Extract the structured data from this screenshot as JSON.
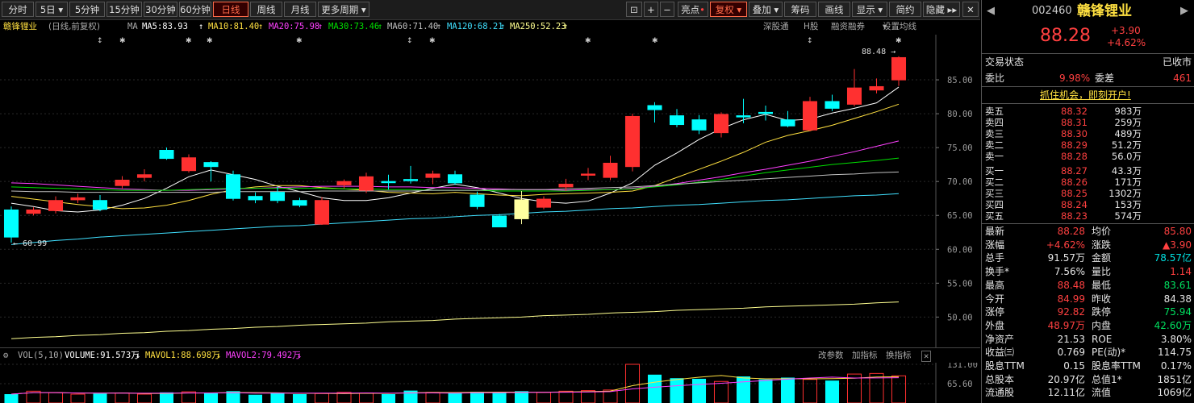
{
  "toolbar": {
    "periods": [
      "分时",
      "5日",
      "5分钟",
      "15分钟",
      "30分钟",
      "60分钟",
      "日线",
      "周线",
      "月线",
      "更多周期"
    ],
    "active_period": "日线",
    "tools": [
      "亮点",
      "复权",
      "叠加",
      "筹码",
      "画线",
      "显示",
      "简约",
      "隐藏"
    ],
    "active_tool": "复权"
  },
  "infobar": {
    "name": "赣锋锂业",
    "mode": "(日线,前复权)",
    "ma_label": "MA",
    "ma5": "MA5:83.93",
    "ma10": "MA10:81.40",
    "ma20": "MA20:75.98",
    "ma30": "MA30:73.46",
    "ma60": "MA60:71.40",
    "ma120": "MA120:68.21",
    "ma250": "MA250:52.23",
    "right_links": [
      "深股通",
      "H股",
      "融资融券",
      "设置均线"
    ],
    "colors": {
      "ma5": "#ffffff",
      "ma10": "#ffe040",
      "ma20": "#ff40ff",
      "ma30": "#00e000",
      "ma60": "#c0c0c0",
      "ma120": "#40e0ff",
      "ma250": "#ffff90"
    }
  },
  "chart_data": [
    {
      "type": "candlestick",
      "title": "赣锋锂业 日线 前复权",
      "price_axis": {
        "ylim": [
          46,
          90
        ],
        "ticks": [
          85.0,
          80.0,
          75.0,
          70.0,
          65.0,
          60.0,
          55.0,
          50.0
        ]
      },
      "candles": [
        {
          "o": 65.8,
          "c": 61.8,
          "h": 66.3,
          "l": 60.99,
          "up": false
        },
        {
          "o": 65.3,
          "c": 65.8,
          "h": 66.2,
          "l": 65.0,
          "up": true
        },
        {
          "o": 65.7,
          "c": 67.2,
          "h": 67.8,
          "l": 65.3,
          "up": true
        },
        {
          "o": 67.3,
          "c": 67.6,
          "h": 68.2,
          "l": 66.8,
          "up": true
        },
        {
          "o": 67.2,
          "c": 65.9,
          "h": 68.0,
          "l": 65.6,
          "up": false
        },
        {
          "o": 69.4,
          "c": 70.2,
          "h": 70.8,
          "l": 69.0,
          "up": true
        },
        {
          "o": 70.6,
          "c": 71.0,
          "h": 71.8,
          "l": 70.0,
          "up": true
        },
        {
          "o": 74.6,
          "c": 73.4,
          "h": 75.0,
          "l": 73.2,
          "up": false
        },
        {
          "o": 71.6,
          "c": 73.5,
          "h": 74.0,
          "l": 71.3,
          "up": true
        },
        {
          "o": 72.8,
          "c": 72.2,
          "h": 73.0,
          "l": 70.0,
          "up": false
        },
        {
          "o": 71.0,
          "c": 67.5,
          "h": 71.6,
          "l": 67.2,
          "up": false
        },
        {
          "o": 67.8,
          "c": 67.3,
          "h": 68.4,
          "l": 66.8,
          "up": false
        },
        {
          "o": 68.4,
          "c": 67.2,
          "h": 69.2,
          "l": 66.8,
          "up": false
        },
        {
          "o": 67.2,
          "c": 66.5,
          "h": 67.6,
          "l": 66.2,
          "up": false
        },
        {
          "o": 67.2,
          "c": 63.7,
          "h": 67.7,
          "l": 63.6,
          "up": true
        },
        {
          "o": 69.5,
          "c": 70.0,
          "h": 70.3,
          "l": 69.0,
          "up": true
        },
        {
          "o": 68.7,
          "c": 70.7,
          "h": 71.3,
          "l": 68.3,
          "up": true
        },
        {
          "o": 70.0,
          "c": 70.0,
          "h": 71.0,
          "l": 68.8,
          "up": false
        },
        {
          "o": 70.3,
          "c": 70.3,
          "h": 72.3,
          "l": 69.7,
          "up": false
        },
        {
          "o": 70.6,
          "c": 71.1,
          "h": 71.6,
          "l": 69.6,
          "up": true
        },
        {
          "o": 71.0,
          "c": 69.8,
          "h": 71.6,
          "l": 69.5,
          "up": false
        },
        {
          "o": 68.0,
          "c": 66.3,
          "h": 68.5,
          "l": 65.9,
          "up": false
        },
        {
          "o": 64.9,
          "c": 63.3,
          "h": 65.2,
          "l": 63.3,
          "up": false
        },
        {
          "o": 67.3,
          "c": 64.5,
          "h": 68.6,
          "l": 63.7,
          "neutral": true
        },
        {
          "o": 66.2,
          "c": 67.4,
          "h": 67.8,
          "l": 65.9,
          "up": true
        },
        {
          "o": 69.2,
          "c": 69.6,
          "h": 70.4,
          "l": 68.6,
          "up": true
        },
        {
          "o": 71.0,
          "c": 71.1,
          "h": 72.0,
          "l": 70.2,
          "up": true
        },
        {
          "o": 70.6,
          "c": 72.7,
          "h": 73.8,
          "l": 70.2,
          "up": true
        },
        {
          "o": 72.2,
          "c": 79.6,
          "h": 80.0,
          "l": 71.5,
          "up": true
        },
        {
          "o": 81.2,
          "c": 80.6,
          "h": 81.7,
          "l": 78.7,
          "up": false
        },
        {
          "o": 79.7,
          "c": 78.4,
          "h": 80.7,
          "l": 78.0,
          "up": false
        },
        {
          "o": 79.1,
          "c": 77.6,
          "h": 79.8,
          "l": 77.0,
          "up": false
        },
        {
          "o": 77.2,
          "c": 79.9,
          "h": 80.2,
          "l": 76.5,
          "up": true
        },
        {
          "o": 79.7,
          "c": 79.7,
          "h": 82.2,
          "l": 78.6,
          "up": false
        },
        {
          "o": 80.2,
          "c": 80.2,
          "h": 81.2,
          "l": 79.0,
          "up": false
        },
        {
          "o": 78.2,
          "c": 79.1,
          "h": 80.4,
          "l": 78.0,
          "up": false
        },
        {
          "o": 77.6,
          "c": 81.8,
          "h": 82.5,
          "l": 77.4,
          "up": true
        },
        {
          "o": 81.8,
          "c": 80.8,
          "h": 82.8,
          "l": 80.4,
          "up": false
        },
        {
          "o": 81.4,
          "c": 83.8,
          "h": 86.6,
          "l": 81.1,
          "up": true
        },
        {
          "o": 83.5,
          "c": 84.0,
          "h": 85.2,
          "l": 83.0,
          "up": true
        },
        {
          "o": 84.99,
          "c": 88.28,
          "h": 88.48,
          "l": 84.1,
          "up": true
        }
      ],
      "annotations": {
        "high": "88.48",
        "low": "60.99"
      },
      "ma_lines": {
        "ma5": [
          66.8,
          66.3,
          65.7,
          65.5,
          65.8,
          66.5,
          67.5,
          69.0,
          70.7,
          71.7,
          71.0,
          70.3,
          69.3,
          68.5,
          67.6,
          67.2,
          67.2,
          67.6,
          68.3,
          69.0,
          69.6,
          69.1,
          68.3,
          67.5,
          67.0,
          66.8,
          67.1,
          68.3,
          69.8,
          72.4,
          74.2,
          76.2,
          77.8,
          79.1,
          79.9,
          79.0,
          79.2,
          80.1,
          80.8,
          81.6,
          83.93
        ],
        "ma10": [
          67.8,
          67.4,
          67.0,
          66.6,
          66.3,
          66.0,
          66.1,
          66.5,
          67.2,
          68.1,
          68.8,
          69.2,
          69.4,
          69.4,
          69.1,
          68.9,
          68.7,
          68.4,
          68.3,
          68.2,
          68.4,
          68.2,
          68.0,
          67.9,
          68.1,
          68.2,
          68.3,
          68.4,
          68.6,
          69.4,
          70.6,
          71.8,
          73.0,
          74.3,
          75.8,
          76.8,
          77.5,
          78.3,
          79.3,
          80.3,
          81.4
        ],
        "ma20": [
          69.8,
          69.7,
          69.5,
          69.3,
          69.1,
          68.9,
          68.8,
          68.7,
          68.7,
          68.8,
          68.9,
          69.0,
          69.1,
          69.2,
          69.3,
          69.3,
          69.3,
          69.2,
          69.2,
          69.1,
          69.1,
          69.0,
          68.9,
          68.8,
          68.8,
          68.7,
          68.8,
          68.8,
          69.0,
          69.3,
          69.7,
          70.2,
          70.7,
          71.3,
          71.8,
          72.4,
          73.0,
          73.7,
          74.4,
          75.2,
          75.98
        ],
        "ma30": [
          69.2,
          69.1,
          69.0,
          68.9,
          68.8,
          68.7,
          68.7,
          68.7,
          68.8,
          68.9,
          69.0,
          69.0,
          69.0,
          69.0,
          69.0,
          68.9,
          68.9,
          68.8,
          68.8,
          68.7,
          68.7,
          68.7,
          68.6,
          68.6,
          68.6,
          68.6,
          68.7,
          68.8,
          68.9,
          69.2,
          69.5,
          69.9,
          70.3,
          70.8,
          71.3,
          71.7,
          72.1,
          72.5,
          72.8,
          73.1,
          73.46
        ],
        "ma60": [
          68.6,
          68.5,
          68.5,
          68.4,
          68.4,
          68.4,
          68.4,
          68.4,
          68.4,
          68.4,
          68.5,
          68.5,
          68.5,
          68.5,
          68.6,
          68.6,
          68.6,
          68.6,
          68.6,
          68.7,
          68.7,
          68.7,
          68.8,
          68.8,
          68.8,
          68.9,
          69.0,
          69.1,
          69.2,
          69.4,
          69.6,
          69.8,
          70.0,
          70.2,
          70.4,
          70.6,
          70.8,
          71.0,
          71.1,
          71.3,
          71.4
        ],
        "ma120": [
          60.7,
          61.0,
          61.3,
          61.5,
          61.8,
          62.0,
          62.2,
          62.4,
          62.6,
          62.8,
          63.0,
          63.2,
          63.4,
          63.5,
          63.7,
          63.9,
          64.1,
          64.3,
          64.5,
          64.6,
          64.8,
          65.0,
          65.1,
          65.3,
          65.5,
          65.6,
          65.8,
          66.0,
          66.1,
          66.3,
          66.5,
          66.6,
          66.8,
          67.0,
          67.2,
          67.3,
          67.5,
          67.7,
          67.9,
          68.0,
          68.21
        ],
        "ma250": [
          46.8,
          47.0,
          47.1,
          47.3,
          47.4,
          47.6,
          47.7,
          47.9,
          48.0,
          48.2,
          48.3,
          48.5,
          48.6,
          48.8,
          48.9,
          49.0,
          49.1,
          49.3,
          49.4,
          49.5,
          49.7,
          49.8,
          49.9,
          50.0,
          50.2,
          50.3,
          50.4,
          50.6,
          50.7,
          50.8,
          51.0,
          51.1,
          51.2,
          51.3,
          51.5,
          51.6,
          51.7,
          51.8,
          51.9,
          52.1,
          52.23
        ]
      }
    },
    {
      "type": "bar",
      "title": "VOL(5,10)",
      "volume_axis": {
        "ticks": [
          "131.00",
          "65.60"
        ]
      },
      "vol_label": "VOLUME:91.573万",
      "mavol1_label": "MAVOL1:88.698万",
      "mavol2_label": "MAVOL2:79.492万",
      "values": [
        30,
        40,
        35,
        30,
        32,
        34,
        30,
        36,
        38,
        33,
        40,
        28,
        33,
        30,
        32,
        36,
        34,
        30,
        42,
        36,
        35,
        38,
        34,
        40,
        36,
        40,
        42,
        44,
        131,
        96,
        84,
        82,
        73,
        90,
        80,
        86,
        80,
        76,
        98,
        100,
        92
      ]
    }
  ],
  "volbar": {
    "title": "VOL(5,10)",
    "volume": "VOLUME:91.573万",
    "mavol1": "MAVOL1:88.698万",
    "mavol2": "MAVOL2:79.492万",
    "links": [
      "改参数",
      "加指标",
      "换指标"
    ]
  },
  "quote": {
    "code": "002460",
    "name": "赣锋锂业",
    "price": "88.28",
    "change": "+3.90",
    "change_pct": "+4.62%",
    "status_label": "交易状态",
    "status_value": "已收市",
    "webi_label": "委比",
    "webi_value": "9.98%",
    "weicha_label": "委差",
    "weicha_value": "461",
    "promo": "抓住机会，即刻开户!",
    "asks": [
      {
        "label": "卖五",
        "price": "88.32",
        "vol": "983万"
      },
      {
        "label": "卖四",
        "price": "88.31",
        "vol": "259万"
      },
      {
        "label": "卖三",
        "price": "88.30",
        "vol": "489万"
      },
      {
        "label": "卖二",
        "price": "88.29",
        "vol": "51.2万"
      },
      {
        "label": "卖一",
        "price": "88.28",
        "vol": "56.0万"
      }
    ],
    "bids": [
      {
        "label": "买一",
        "price": "88.27",
        "vol": "43.3万"
      },
      {
        "label": "买二",
        "price": "88.26",
        "vol": "171万"
      },
      {
        "label": "买三",
        "price": "88.25",
        "vol": "1302万"
      },
      {
        "label": "买四",
        "price": "88.24",
        "vol": "153万"
      },
      {
        "label": "买五",
        "price": "88.23",
        "vol": "574万"
      }
    ],
    "stats": [
      {
        "l1": "最新",
        "v1": "88.28",
        "c1": "red",
        "l2": "均价",
        "v2": "85.80",
        "c2": "red"
      },
      {
        "l1": "涨幅",
        "v1": "+4.62%",
        "c1": "red",
        "l2": "涨跌",
        "v2": "▲3.90",
        "c2": "red"
      },
      {
        "l1": "总手",
        "v1": "91.57万",
        "c1": "white",
        "l2": "金额",
        "v2": "78.57亿",
        "c2": "cyan"
      },
      {
        "l1": "换手*",
        "v1": "7.56%",
        "c1": "white",
        "l2": "量比",
        "v2": "1.14",
        "c2": "red"
      },
      {
        "l1": "最高",
        "v1": "88.48",
        "c1": "red",
        "l2": "最低",
        "v2": "83.61",
        "c2": "green"
      },
      {
        "l1": "今开",
        "v1": "84.99",
        "c1": "red",
        "l2": "昨收",
        "v2": "84.38",
        "c2": "white"
      },
      {
        "l1": "涨停",
        "v1": "92.82",
        "c1": "red",
        "l2": "跌停",
        "v2": "75.94",
        "c2": "green"
      },
      {
        "l1": "外盘",
        "v1": "48.97万",
        "c1": "red",
        "l2": "内盘",
        "v2": "42.60万",
        "c2": "green"
      },
      {
        "l1": "净资产",
        "v1": "21.53",
        "c1": "white",
        "l2": "ROE",
        "v2": "3.80%",
        "c2": "white"
      },
      {
        "l1": "收益㈢",
        "v1": "0.769",
        "c1": "white",
        "l2": "PE(动)*",
        "v2": "114.75",
        "c2": "white"
      },
      {
        "l1": "股息TTM",
        "v1": "0.15",
        "c1": "white",
        "l2": "股息率TTM",
        "v2": "0.17%",
        "c2": "white"
      },
      {
        "l1": "总股本",
        "v1": "20.97亿",
        "c1": "white",
        "l2": "总值1*",
        "v2": "1851亿",
        "c2": "white"
      },
      {
        "l1": "流通股",
        "v1": "12.11亿",
        "c1": "white",
        "l2": "流值",
        "v2": "1069亿",
        "c2": "white"
      }
    ]
  }
}
